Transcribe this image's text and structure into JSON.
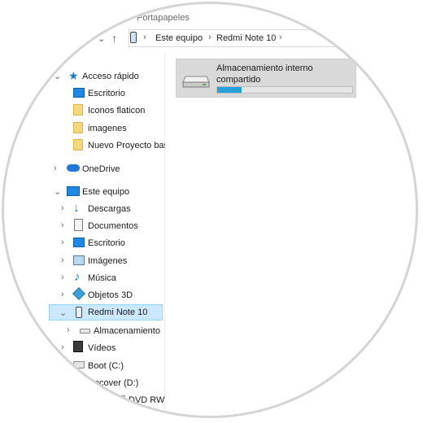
{
  "ribbon": {
    "clipboard_label": "Portapapeles"
  },
  "address": {
    "crumbs": [
      "Este equipo",
      "Redmi Note 10"
    ]
  },
  "sidebar": {
    "items": [
      {
        "label": "Acceso rápido",
        "icon": "star-icon"
      },
      {
        "label": "Escritorio",
        "icon": "desktop-icon"
      },
      {
        "label": "Iconos flaticon",
        "icon": "folder-icon"
      },
      {
        "label": "imagenes",
        "icon": "folder-icon"
      },
      {
        "label": "Nuevo Proyecto bas",
        "icon": "folder-icon"
      },
      {
        "label": "OneDrive",
        "icon": "cloud-icon"
      },
      {
        "label": "Este equipo",
        "icon": "computer-icon"
      },
      {
        "label": "Descargas",
        "icon": "download-arrow-icon"
      },
      {
        "label": "Documentos",
        "icon": "document-icon"
      },
      {
        "label": "Escritorio",
        "icon": "desktop-icon"
      },
      {
        "label": "Imágenes",
        "icon": "pictures-icon"
      },
      {
        "label": "Música",
        "icon": "music-note-icon"
      },
      {
        "label": "Objetos 3D",
        "icon": "cube-3d-icon"
      },
      {
        "label": "Redmi Note 10",
        "icon": "phone-icon"
      },
      {
        "label": "Almacenamiento",
        "icon": "drive-icon"
      },
      {
        "label": "Vídeos",
        "icon": "film-icon"
      },
      {
        "label": "Boot (C:)",
        "icon": "windows-drive-icon"
      },
      {
        "label": "Recover (D:)",
        "icon": "drive-icon"
      },
      {
        "label": "DVD RW",
        "icon": "dvd-icon"
      }
    ]
  },
  "content": {
    "storage": {
      "title": "Almacenamiento interno compartido",
      "used_fraction": 0.18
    }
  },
  "colors": {
    "selection": "#cce8ff",
    "accent": "#26a0da"
  }
}
